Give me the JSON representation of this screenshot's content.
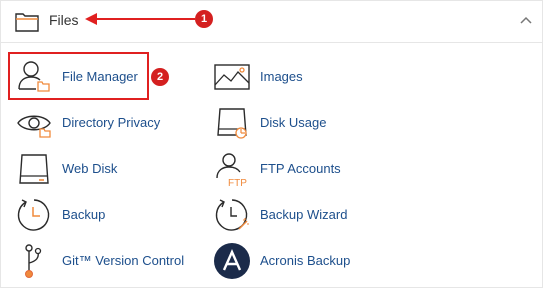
{
  "section": {
    "title": "Files",
    "folder_icon": "folder-icon",
    "collapse_icon": "chevron-up-icon"
  },
  "annotations": {
    "step1": "1",
    "step2": "2",
    "color": "#e02020"
  },
  "items": [
    {
      "label": "File Manager",
      "icon": "file-manager-icon"
    },
    {
      "label": "Images",
      "icon": "images-icon"
    },
    {
      "label": "Directory Privacy",
      "icon": "directory-privacy-icon"
    },
    {
      "label": "Disk Usage",
      "icon": "disk-usage-icon"
    },
    {
      "label": "Web Disk",
      "icon": "web-disk-icon"
    },
    {
      "label": "FTP Accounts",
      "icon": "ftp-accounts-icon"
    },
    {
      "label": "Backup",
      "icon": "backup-icon"
    },
    {
      "label": "Backup Wizard",
      "icon": "backup-wizard-icon"
    },
    {
      "label": "Git™ Version Control",
      "icon": "git-version-control-icon"
    },
    {
      "label": "Acronis Backup",
      "icon": "acronis-backup-icon"
    }
  ],
  "colors": {
    "link": "#1d4f8c",
    "icon_stroke": "#2b2b2b",
    "accent_orange": "#f08a3c",
    "acronis_bg": "#1b2b4a"
  }
}
